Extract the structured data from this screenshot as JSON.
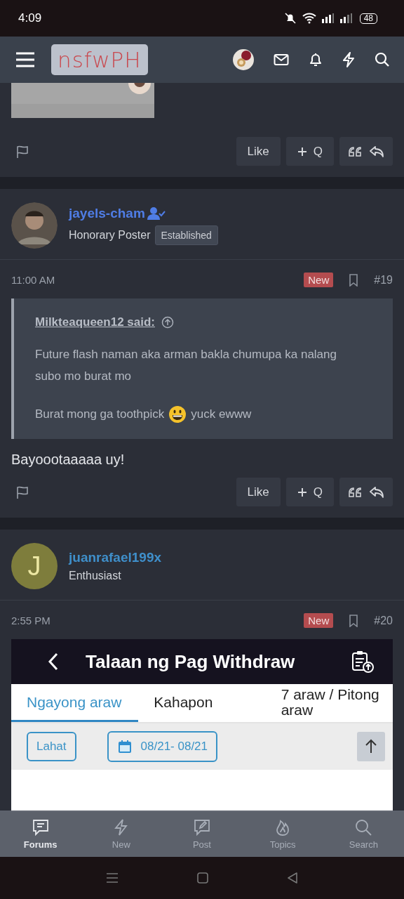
{
  "status_bar": {
    "time": "4:09",
    "battery": "48"
  },
  "header": {
    "logo": "nsfwPH"
  },
  "posts": [
    {
      "kind": "tail",
      "actions": {
        "like": "Like",
        "quote": "Q"
      }
    },
    {
      "kind": "full",
      "author": {
        "name": "jayels-cham",
        "color": "#4f7de6",
        "verified": true,
        "title": "Honorary Poster",
        "badge": "Established"
      },
      "time": "11:00 AM",
      "new": "New",
      "number": "#19",
      "quote": {
        "author": "Milkteaqueen12 said:",
        "text": "Future flash naman aka arman bakla chumupa ka nalang subo mo burat mo",
        "before_emoji": "Burat mong ga toothpick",
        "after_emoji": "yuck ewww"
      },
      "body": "Bayoootaaaaa uy!",
      "actions": {
        "like": "Like",
        "quote": "Q"
      }
    },
    {
      "kind": "full",
      "author": {
        "name": "juanrafael199x",
        "color": "#3f8fca",
        "verified": false,
        "title": "Enthusiast",
        "avatar": {
          "kind": "letter",
          "letter": "J"
        }
      },
      "time": "2:55 PM",
      "new": "New",
      "number": "#20",
      "attachment": {
        "title": "Talaan ng Pag Withdraw",
        "tabs": [
          {
            "label": "Ngayong araw",
            "selected": true
          },
          {
            "label": "Kahapon",
            "selected": false
          },
          {
            "label": "7 araw / Pitong araw",
            "selected": false
          }
        ],
        "filter": "Lahat",
        "date_range": "08/21- 08/21"
      }
    }
  ],
  "bottom_nav": [
    {
      "label": "Forums",
      "selected": true
    },
    {
      "label": "New",
      "selected": false
    },
    {
      "label": "Post",
      "selected": false
    },
    {
      "label": "Topics",
      "selected": false
    },
    {
      "label": "Search",
      "selected": false
    }
  ]
}
